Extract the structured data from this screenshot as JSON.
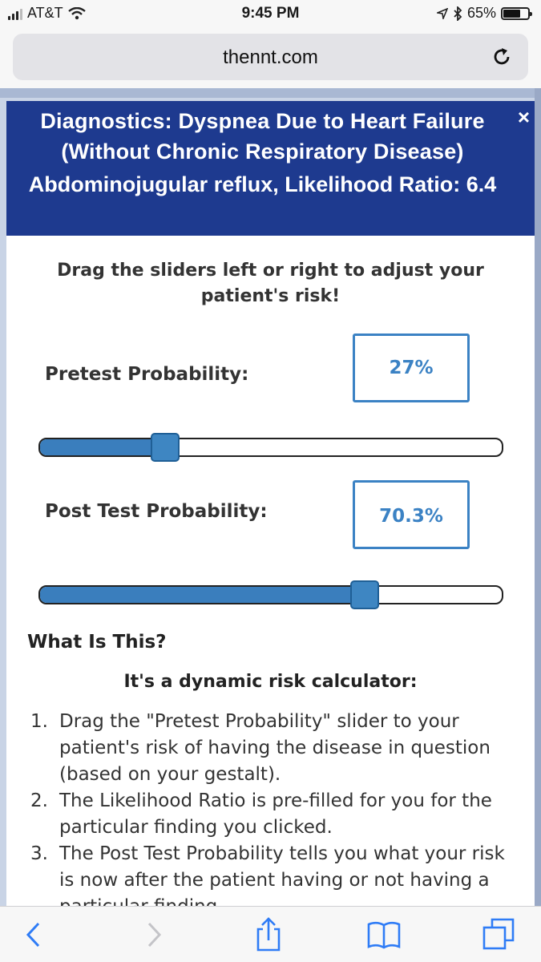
{
  "status_bar": {
    "carrier": "AT&T",
    "time": "9:45 PM",
    "battery": "65%",
    "battery_level": 0.65
  },
  "browser": {
    "url": "thennt.com"
  },
  "modal": {
    "title": "Diagnostics: Dyspnea Due to Heart Failure (Without Chronic Respiratory Disease)",
    "subtitle": "Abdominojugular reflux, Likelihood Ratio: 6.4",
    "close_label": "×",
    "instructions": "Drag the sliders left or right to adjust your patient's risk!",
    "pretest": {
      "label": "Pretest Probability:",
      "value": "27%",
      "fraction": 0.27
    },
    "posttest": {
      "label": "Post Test Probability:",
      "value": "70.3%",
      "fraction": 0.703
    },
    "what_heading": "What Is This?",
    "calc_heading": "It's a dynamic risk calculator:",
    "steps": [
      {
        "num": "1.",
        "text": "Drag the \"Pretest Probability\" slider to your patient's risk of having the disease in question (based on your gestalt)."
      },
      {
        "num": "2.",
        "text": "The Likelihood Ratio is pre-filled for you for the particular finding you clicked."
      },
      {
        "num": "3.",
        "text": "The Post Test Probability tells you what your risk is now after the patient having or not having a particular finding."
      }
    ]
  },
  "colors": {
    "header_blue": "#1e3a8f",
    "accent_blue": "#3b82c4"
  },
  "icons": {
    "toolbar": [
      "back-icon",
      "forward-icon",
      "share-icon",
      "bookmarks-icon",
      "tabs-icon"
    ]
  }
}
